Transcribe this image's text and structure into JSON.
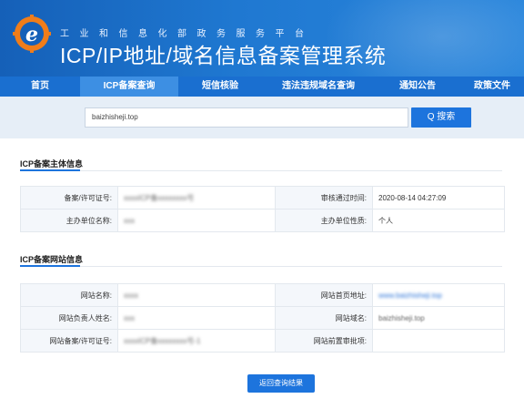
{
  "header": {
    "subtitle": "工业和信息化部政务服务平台",
    "title": "ICP/IP地址/域名信息备案管理系统"
  },
  "nav": {
    "items": [
      {
        "label": "首页"
      },
      {
        "label": "ICP备案查询"
      },
      {
        "label": "短信核验"
      },
      {
        "label": "违法违规域名查询"
      },
      {
        "label": "通知公告"
      },
      {
        "label": "政策文件"
      }
    ]
  },
  "search": {
    "value": "baizhisheji.top",
    "button_label": "Q 搜索"
  },
  "subject_section": {
    "title": "ICP备案主体信息",
    "rows": [
      {
        "label1": "备案/许可证号:",
        "value1": "xxxxICP备xxxxxxxx号",
        "label2": "审核通过时间:",
        "value2": "2020-08-14 04:27:09"
      },
      {
        "label1": "主办单位名称:",
        "value1": "xxx",
        "label2": "主办单位性质:",
        "value2": "个人"
      }
    ]
  },
  "site_section": {
    "title": "ICP备案网站信息",
    "rows": [
      {
        "label1": "网站名称:",
        "value1": "xxxx",
        "label2": "网站首页地址:",
        "value2": "www.baizhisheji.top"
      },
      {
        "label1": "网站负责人姓名:",
        "value1": "xxx",
        "label2": "网站域名:",
        "value2": "baizhisheji.top"
      },
      {
        "label1": "网站备案/许可证号:",
        "value1": "xxxxICP备xxxxxxxx号-1",
        "label2": "网站前置审批项:",
        "value2": ""
      }
    ]
  },
  "back_button_label": "返回查询结果",
  "colors": {
    "primary": "#1d74dd",
    "header": "#1a6fd0",
    "search_band": "#e6eef7"
  }
}
